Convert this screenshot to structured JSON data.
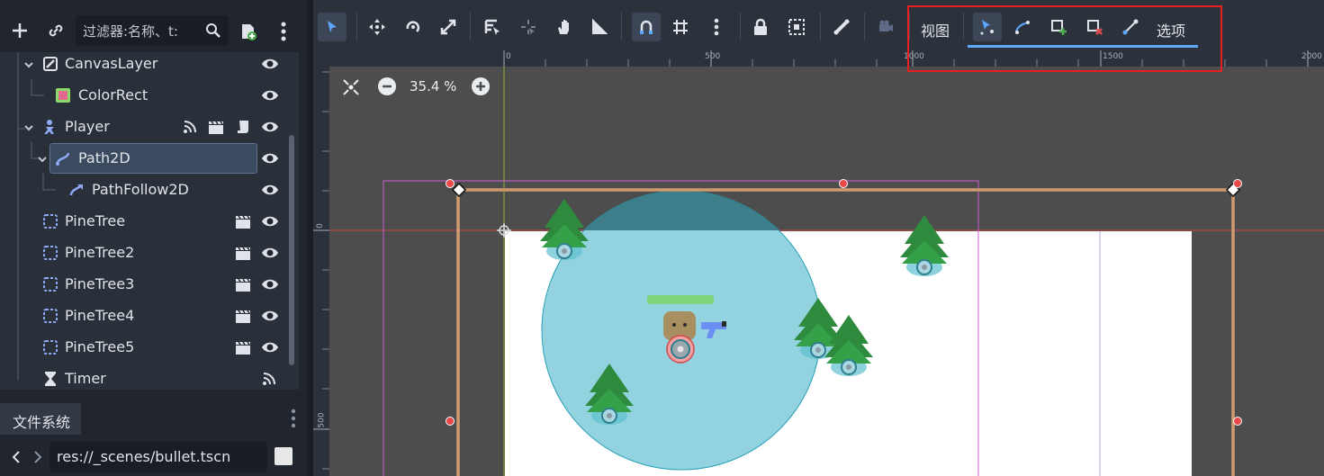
{
  "scene_panel": {
    "filter_placeholder": "过滤器:名称、t:",
    "nodes": [
      {
        "label": "CanvasLayer",
        "icon": "canvas-layer-icon"
      },
      {
        "label": "ColorRect",
        "icon": "color-rect-icon"
      },
      {
        "label": "Player",
        "icon": "character-body-icon"
      },
      {
        "label": "Path2D",
        "icon": "path2d-icon",
        "selected": true
      },
      {
        "label": "PathFollow2D",
        "icon": "path-follow-icon"
      },
      {
        "label": "PineTree",
        "icon": "node2d-icon"
      },
      {
        "label": "PineTree2",
        "icon": "node2d-icon"
      },
      {
        "label": "PineTree3",
        "icon": "node2d-icon"
      },
      {
        "label": "PineTree4",
        "icon": "node2d-icon"
      },
      {
        "label": "PineTree5",
        "icon": "node2d-icon"
      },
      {
        "label": "Timer",
        "icon": "timer-icon"
      }
    ]
  },
  "filesystem": {
    "tab_label": "文件系统",
    "path_value": "res://_scenes/bullet.tscn"
  },
  "toolbar": {
    "view_label": "视图",
    "options_label": "选项"
  },
  "ruler": {
    "top_ticks": [
      "0",
      "500",
      "1000",
      "1500",
      "2000"
    ],
    "left_ticks": [
      "0",
      "500"
    ]
  },
  "zoom": {
    "level": "35.4 %"
  },
  "colors": {
    "accent": "#5fa8ff",
    "highlight_box": "#e62020",
    "tree_green": "#2e8b3e",
    "detection_circle": "#93d3e0"
  }
}
